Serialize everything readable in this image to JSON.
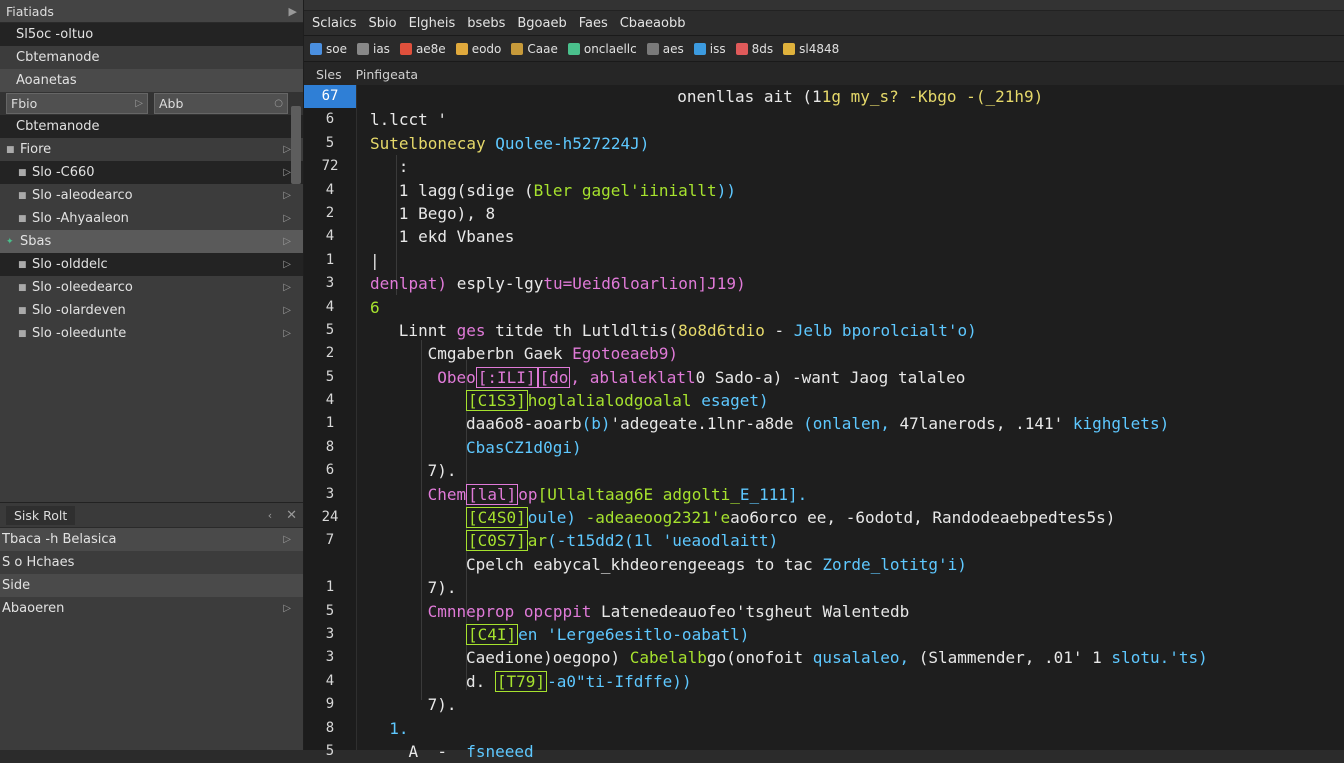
{
  "left_panel": {
    "title": "Fiatiads",
    "rows": [
      {
        "label": "Sl5oc -oltuo",
        "style": "dark",
        "icon": ""
      },
      {
        "label": "Cbtemanode",
        "style": "normal",
        "icon": ""
      },
      {
        "label": "Aoanetas",
        "style": "mid",
        "icon": ""
      },
      {
        "label": "Cbtemanode",
        "style": "dark",
        "icon": ""
      },
      {
        "label": "Fiore",
        "style": "normal",
        "icon": "bullet"
      },
      {
        "label": "Slo -C660",
        "style": "dark",
        "icon": "bullet"
      },
      {
        "label": "Slo -aleodearco",
        "style": "normal",
        "icon": "bullet"
      },
      {
        "label": "Slo -Ahyaaleon",
        "style": "normal",
        "icon": "bullet"
      },
      {
        "label": "Sbas",
        "style": "sel",
        "icon": "star"
      },
      {
        "label": "Slo -olddelc",
        "style": "dark",
        "icon": "bullet"
      },
      {
        "label": "Slo -oleedearco",
        "style": "normal",
        "icon": "bullet"
      },
      {
        "label": "Slo -olardeven",
        "style": "normal",
        "icon": "bullet"
      },
      {
        "label": "Slo -oleedunte",
        "style": "normal",
        "icon": "bullet"
      }
    ],
    "field_left": "Fbio",
    "field_right": "Abb"
  },
  "bottom_panel": {
    "title": "Sisk Rolt",
    "rows": [
      {
        "label": "Tbaca -h Belasica"
      },
      {
        "label": "S o Hchaes"
      },
      {
        "label": "Side"
      },
      {
        "label": "Abaoeren"
      }
    ]
  },
  "menubar": [
    "Sclaics",
    "Sbio",
    "Elgheis",
    "bsebs",
    "Bgoaeb",
    "Faes",
    "Cbaeaobb"
  ],
  "toolbar": [
    {
      "label": "soe",
      "color": "#4a8fe0"
    },
    {
      "label": "ias",
      "color": "#888888"
    },
    {
      "label": "ae8e",
      "color": "#e0503c"
    },
    {
      "label": "eodo",
      "color": "#e0a93c"
    },
    {
      "label": "Caae",
      "color": "#c79a3a"
    },
    {
      "label": "onclaellc",
      "color": "#4ac08c"
    },
    {
      "label": "aes",
      "color": "#7a7a7a"
    },
    {
      "label": "iss",
      "color": "#3c9be0"
    },
    {
      "label": "8ds",
      "color": "#e05a5a"
    },
    {
      "label": "sl4848",
      "color": "#e0b23c"
    }
  ],
  "tabs": [
    "Sles",
    "Pinfigeata"
  ],
  "line_numbers": [
    "67",
    "6",
    "5",
    "72",
    "4",
    "2",
    "4",
    "1",
    "3",
    "4",
    "5",
    "2",
    "5",
    "4",
    "1",
    "8",
    "6",
    "3",
    "24",
    "7",
    "",
    "1",
    "5",
    "3",
    "3",
    "4",
    "9",
    "8",
    "5"
  ],
  "current_line": "67",
  "code": [
    {
      "indent": 32,
      "parts": [
        {
          "t": "onenllas ait (1",
          "c": "w"
        },
        {
          "t": "1g my_s? -Kbgo -(_21h9)",
          "c": "y"
        }
      ]
    },
    {
      "indent": 0,
      "parts": [
        {
          "t": "l.lcct '",
          "c": "w"
        }
      ]
    },
    {
      "indent": 0,
      "parts": [
        {
          "t": "Sutelbonecay ",
          "c": "y"
        },
        {
          "t": "Quolee-h527224J)",
          "c": "c"
        }
      ]
    },
    {
      "indent": 3,
      "parts": [
        {
          "t": ":",
          "c": "w"
        }
      ]
    },
    {
      "indent": 3,
      "parts": [
        {
          "t": "1 lagg(sdige (",
          "c": "w"
        },
        {
          "t": "Bler gage",
          "c": "g"
        },
        {
          "t": "l'iiniallt",
          "c": "g"
        },
        {
          "t": "))",
          "c": "c"
        }
      ]
    },
    {
      "indent": 3,
      "parts": [
        {
          "t": "1 Bego), 8",
          "c": "w"
        }
      ]
    },
    {
      "indent": 3,
      "parts": [
        {
          "t": "1 ekd Vbanes",
          "c": "w"
        }
      ]
    },
    {
      "indent": 0,
      "parts": [
        {
          "t": "|",
          "c": "w"
        }
      ]
    },
    {
      "indent": 0,
      "parts": [
        {
          "t": "denlpat) ",
          "c": "p"
        },
        {
          "t": "esply-lgy",
          "c": "w"
        },
        {
          "t": "tu=Ueid6loarlion]J19)",
          "c": "p"
        }
      ]
    },
    {
      "indent": 0,
      "parts": [
        {
          "t": "6",
          "c": "g"
        }
      ]
    },
    {
      "indent": 3,
      "parts": [
        {
          "t": "Linnt ",
          "c": "w"
        },
        {
          "t": "ges ",
          "c": "p"
        },
        {
          "t": "titde th Lutldltis(",
          "c": "w"
        },
        {
          "t": "8o8d6tdio",
          "c": "y"
        },
        {
          "t": " - ",
          "c": "w"
        },
        {
          "t": "Jelb bporolcialt'o)",
          "c": "c"
        }
      ]
    },
    {
      "indent": 6,
      "parts": [
        {
          "t": "Cmgaberbn Gaek ",
          "c": "w"
        },
        {
          "t": "Egotoeaeb9)",
          "c": "p"
        }
      ]
    },
    {
      "indent": 7,
      "parts": [
        {
          "t": "Obeo",
          "c": "p"
        },
        {
          "t": "[:ILI]",
          "c": "bxp"
        },
        {
          "t": "[do",
          "c": "bxp"
        },
        {
          "t": ", ablaleklatl",
          "c": "p"
        },
        {
          "t": "0 Sado-a) ",
          "c": "w"
        },
        {
          "t": "-want Jaog talaleo",
          "c": "w"
        }
      ]
    },
    {
      "indent": 10,
      "parts": [
        {
          "t": "[C1S3]",
          "c": "bx"
        },
        {
          "t": "hoglali",
          "c": "g"
        },
        {
          "t": "al",
          "c": "g"
        },
        {
          "t": "odgoalal ",
          "c": "g"
        },
        {
          "t": "esaget)",
          "c": "c"
        }
      ]
    },
    {
      "indent": 10,
      "parts": [
        {
          "t": "daa6o8-aoarb",
          "c": "w"
        },
        {
          "t": "(b)",
          "c": "c"
        },
        {
          "t": "'adegeate.1lnr-a8de ",
          "c": "w"
        },
        {
          "t": "(onlalen, ",
          "c": "c"
        },
        {
          "t": "47lanerods, .141' ",
          "c": "w"
        },
        {
          "t": "kighglets)",
          "c": "c"
        }
      ]
    },
    {
      "indent": 10,
      "parts": [
        {
          "t": "CbasCZ1d0gi)",
          "c": "c"
        }
      ]
    },
    {
      "indent": 6,
      "parts": [
        {
          "t": "7).",
          "c": "w"
        }
      ]
    },
    {
      "indent": 6,
      "parts": [
        {
          "t": "Chem",
          "c": "p"
        },
        {
          "t": "[lal]",
          "c": "bxp"
        },
        {
          "t": "op",
          "c": "p"
        },
        {
          "t": "[Ullaltaag6E",
          "c": "g"
        },
        {
          "t": " adgolti_",
          "c": "g"
        },
        {
          "t": "E_111].",
          "c": "c"
        }
      ]
    },
    {
      "indent": 10,
      "parts": [
        {
          "t": "[C4S0]",
          "c": "bx"
        },
        {
          "t": "oule) ",
          "c": "c"
        },
        {
          "t": "-adeaeoog2321'e",
          "c": "g"
        },
        {
          "t": "ao6orco ee, ",
          "c": "w"
        },
        {
          "t": "-6odotd, ",
          "c": "w"
        },
        {
          "t": "Randodeaebpedtes5s)",
          "c": "w"
        }
      ]
    },
    {
      "indent": 10,
      "parts": [
        {
          "t": "[C0S7]",
          "c": "bx"
        },
        {
          "t": "ar",
          "c": "g"
        },
        {
          "t": "(-t15dd2(1l ",
          "c": "c"
        },
        {
          "t": "'ueaod",
          "c": "c"
        },
        {
          "t": "laitt)",
          "c": "c"
        }
      ]
    },
    {
      "indent": 10,
      "parts": [
        {
          "t": "Cpelch eabycal_khdeorengeeags to tac ",
          "c": "w"
        },
        {
          "t": "Zorde_lotitg'i)",
          "c": "c"
        }
      ]
    },
    {
      "indent": 6,
      "parts": [
        {
          "t": "7).",
          "c": "w"
        }
      ]
    },
    {
      "indent": 6,
      "parts": [
        {
          "t": "Cmnneprop opcppit ",
          "c": "p"
        },
        {
          "t": "Latenedeauofeo'tsgheut Walentedb",
          "c": "w"
        }
      ]
    },
    {
      "indent": 10,
      "parts": [
        {
          "t": "[C4I]",
          "c": "bx"
        },
        {
          "t": "en '",
          "c": "c"
        },
        {
          "t": "Lerge6esitlo-oabatl",
          "c": "c"
        },
        {
          "t": ")",
          "c": "c"
        }
      ]
    },
    {
      "indent": 10,
      "parts": [
        {
          "t": "Caedione)oegopo) ",
          "c": "w"
        },
        {
          "t": "Cabelalb",
          "c": "g"
        },
        {
          "t": "go(onofoit ",
          "c": "w"
        },
        {
          "t": "qusalaleo, ",
          "c": "c"
        },
        {
          "t": "(Slammender, .01' 1 ",
          "c": "w"
        },
        {
          "t": "slotu.'ts)",
          "c": "c"
        }
      ]
    },
    {
      "indent": 10,
      "parts": [
        {
          "t": "d. ",
          "c": "w"
        },
        {
          "t": "[T79]",
          "c": "bx"
        },
        {
          "t": "-a0\"ti-Ifdffe))",
          "c": "c"
        }
      ]
    },
    {
      "indent": 6,
      "parts": [
        {
          "t": "7).",
          "c": "w"
        }
      ]
    },
    {
      "indent": 2,
      "parts": [
        {
          "t": "1.",
          "c": "c"
        }
      ]
    },
    {
      "indent": 2,
      "parts": [
        {
          "t": "  A  -  ",
          "c": "w"
        },
        {
          "t": "fsneeed",
          "c": "c"
        }
      ]
    }
  ]
}
